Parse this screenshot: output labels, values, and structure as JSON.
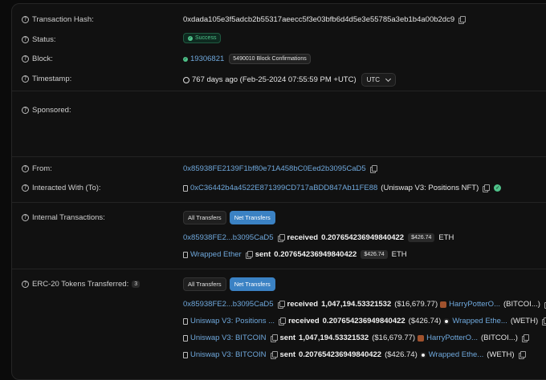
{
  "labels": {
    "tx_hash": "Transaction Hash:",
    "status": "Status:",
    "block": "Block:",
    "timestamp": "Timestamp:",
    "sponsored": "Sponsored:",
    "from": "From:",
    "interacted": "Interacted With (To):",
    "internal": "Internal Transactions:",
    "erc20": "ERC-20 Tokens Transferred:"
  },
  "tx_hash": "0xdada105e3f5adcb2b55317aeecc5f3e03bfb6d4d5e3e55785a3eb1b4a00b2dc9",
  "status": "Success",
  "block": {
    "number": "19306821",
    "confirmations": "5490010 Block Confirmations"
  },
  "timestamp": {
    "text": "767 days ago (Feb-25-2024 07:55:59 PM +UTC)",
    "zone": "UTC"
  },
  "from": "0x85938FE2139F1bf80e71A458bC0Eed2b3095CaD5",
  "interacted": {
    "address": "0xC36442b4a4522E871399CD717aBDD847Ab11FE88",
    "name": "(Uniswap V3: Positions NFT)"
  },
  "tabs": {
    "all": "All Transfers",
    "net": "Net Transfers"
  },
  "internal": [
    {
      "who": "0x85938FE2...b3095CaD5",
      "action": "received",
      "amount": "0.207654236949840422",
      "usd": "$426.74",
      "unit": "ETH"
    },
    {
      "who": "Wrapped Ether",
      "action": "sent",
      "amount": "0.207654236949840422",
      "usd": "$426.74",
      "unit": "ETH"
    }
  ],
  "erc20_count": "3",
  "erc20": [
    {
      "who": "0x85938FE2...b3095CaD5",
      "action": "received",
      "amount": "1,047,194.53321532",
      "usd": "($16,679.77)",
      "token": "HarryPotterO...",
      "symbol": "(BITCOI...)"
    },
    {
      "who": "Uniswap V3: Positions ...",
      "action": "received",
      "amount": "0.207654236949840422",
      "usd": "($426.74)",
      "token": "Wrapped Ethe...",
      "symbol": "(WETH)"
    },
    {
      "who": "Uniswap V3: BITCOIN",
      "action": "sent",
      "amount": "1,047,194.53321532",
      "usd": "($16,679.77)",
      "token": "HarryPotterO...",
      "symbol": "(BITCOI...)"
    },
    {
      "who": "Uniswap V3: BITCOIN",
      "action": "sent",
      "amount": "0.207654236949840422",
      "usd": "($426.74)",
      "token": "Wrapped Ethe...",
      "symbol": "(WETH)"
    }
  ]
}
